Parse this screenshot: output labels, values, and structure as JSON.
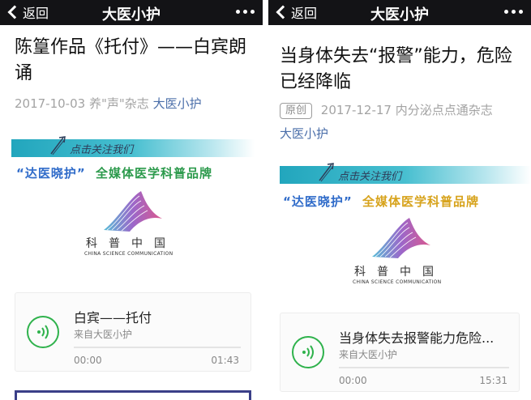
{
  "left": {
    "navbar": {
      "back_label": "返回",
      "title": "大医小护"
    },
    "article": {
      "title": "陈篁作品《托付》——白宾朗诵",
      "date": "2017-10-03",
      "source": "养\"声\"杂志",
      "account": "大医小护"
    },
    "banner": {
      "text": "点击关注我们"
    },
    "slogan": {
      "part1": "“达医晓护”",
      "part2": "全媒体医学科普品牌"
    },
    "logo": {
      "cn": "科普中国",
      "en": "CHINA SCIENCE COMMUNICATION"
    },
    "audio": {
      "title": "白宾——托付",
      "source": "来自大医小护",
      "current": "00:00",
      "duration": "01:43"
    }
  },
  "right": {
    "navbar": {
      "back_label": "返回",
      "title": "大医小护"
    },
    "article": {
      "title": "当身体失去“报警”能力，危险已经降临",
      "badge": "原创",
      "date": "2017-12-17",
      "source": "内分泌点点通杂志",
      "account": "大医小护"
    },
    "banner": {
      "text": "点击关注我们"
    },
    "slogan": {
      "part1": "“达医晓护”",
      "part2": "全媒体医学科普品牌"
    },
    "logo": {
      "cn": "科普中国",
      "en": "CHINA SCIENCE COMMUNICATION"
    },
    "audio": {
      "title": "当身体失去报警能力危险...",
      "source": "来自大医小护",
      "current": "00:00",
      "duration": "15:31"
    }
  },
  "colors": {
    "navbar": "#131316",
    "play_green": "#2fb24c",
    "link_blue": "#4a6ea9",
    "banner_teal": "#22a6bd"
  },
  "icons": {
    "back": "chevron-left-icon",
    "more": "more-dots-icon",
    "play": "audio-wave-icon",
    "arrow": "click-arrow-icon"
  }
}
